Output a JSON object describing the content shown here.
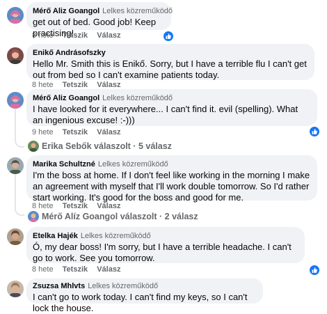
{
  "comments": [
    {
      "author": "Mérő Aliz Goangol",
      "badge": "Lelkes közreműködő",
      "text": "get out of bed. Good job! Keep practising!",
      "time": "8 hete",
      "like_label": "Tetszik",
      "reply_label": "Válasz",
      "avatar_color": "#d96fa3"
    },
    {
      "author": "Enikő Andrásofszky",
      "badge": "",
      "text": "Hello Mr. Smith this is Enikő. Sorry, but I have a terrible flu I can't get out from bed so I can't examine patients today.",
      "time": "8 hete",
      "like_label": "Tetszik",
      "reply_label": "Válasz",
      "avatar_color": "#a0524e"
    },
    {
      "author": "Mérő Aliz Goangol",
      "badge": "Lelkes közreműködő",
      "text": "I have looked for it everywhere... I can't find it. evil (spelling). What an ingenious excuse! :-)))",
      "time": "9 hete",
      "like_label": "Tetszik",
      "reply_label": "Válasz",
      "avatar_color": "#d96fa3"
    },
    {
      "author": "Marika Schultzné",
      "badge": "Lelkes közreműködő",
      "text": "I'm the boss at home. If I don't feel like working in the morning I make an agreement with myself that I'll work double tomorrow. So I'd rather start working. It's good for the boss and good for me.",
      "time": "8 hete",
      "like_label": "Tetszik",
      "reply_label": "Válasz",
      "avatar_color": "#7b8a6e"
    },
    {
      "author": "Etelka Hajék",
      "badge": "Lelkes közreműködő",
      "text": "Ó, my dear boss! I'm sorry, but I have a terrible headache. I can't go to work. See you tomorrow.",
      "time": "8 hete",
      "like_label": "Tetszik",
      "reply_label": "Válasz",
      "avatar_color": "#8a6a4a"
    },
    {
      "author": "Zsuzsa Mhlvts",
      "badge": "Lelkes közreműködő",
      "text": "I can't go to work today. I can't find my keys, so I can't lock the house.",
      "avatar_color": "#9a7a5a"
    }
  ],
  "replies": [
    {
      "text": "Erika Sebők válaszolt · 5 válasz",
      "avatar_color": "#6a8a5a"
    },
    {
      "text": "Mérő Alíz Goangol válaszolt · 2 válasz",
      "avatar_color": "#d96fa3"
    }
  ],
  "colors": {
    "like_blue": "#1877f2",
    "bubble": "#f0f2f5",
    "muted": "#65676b"
  }
}
